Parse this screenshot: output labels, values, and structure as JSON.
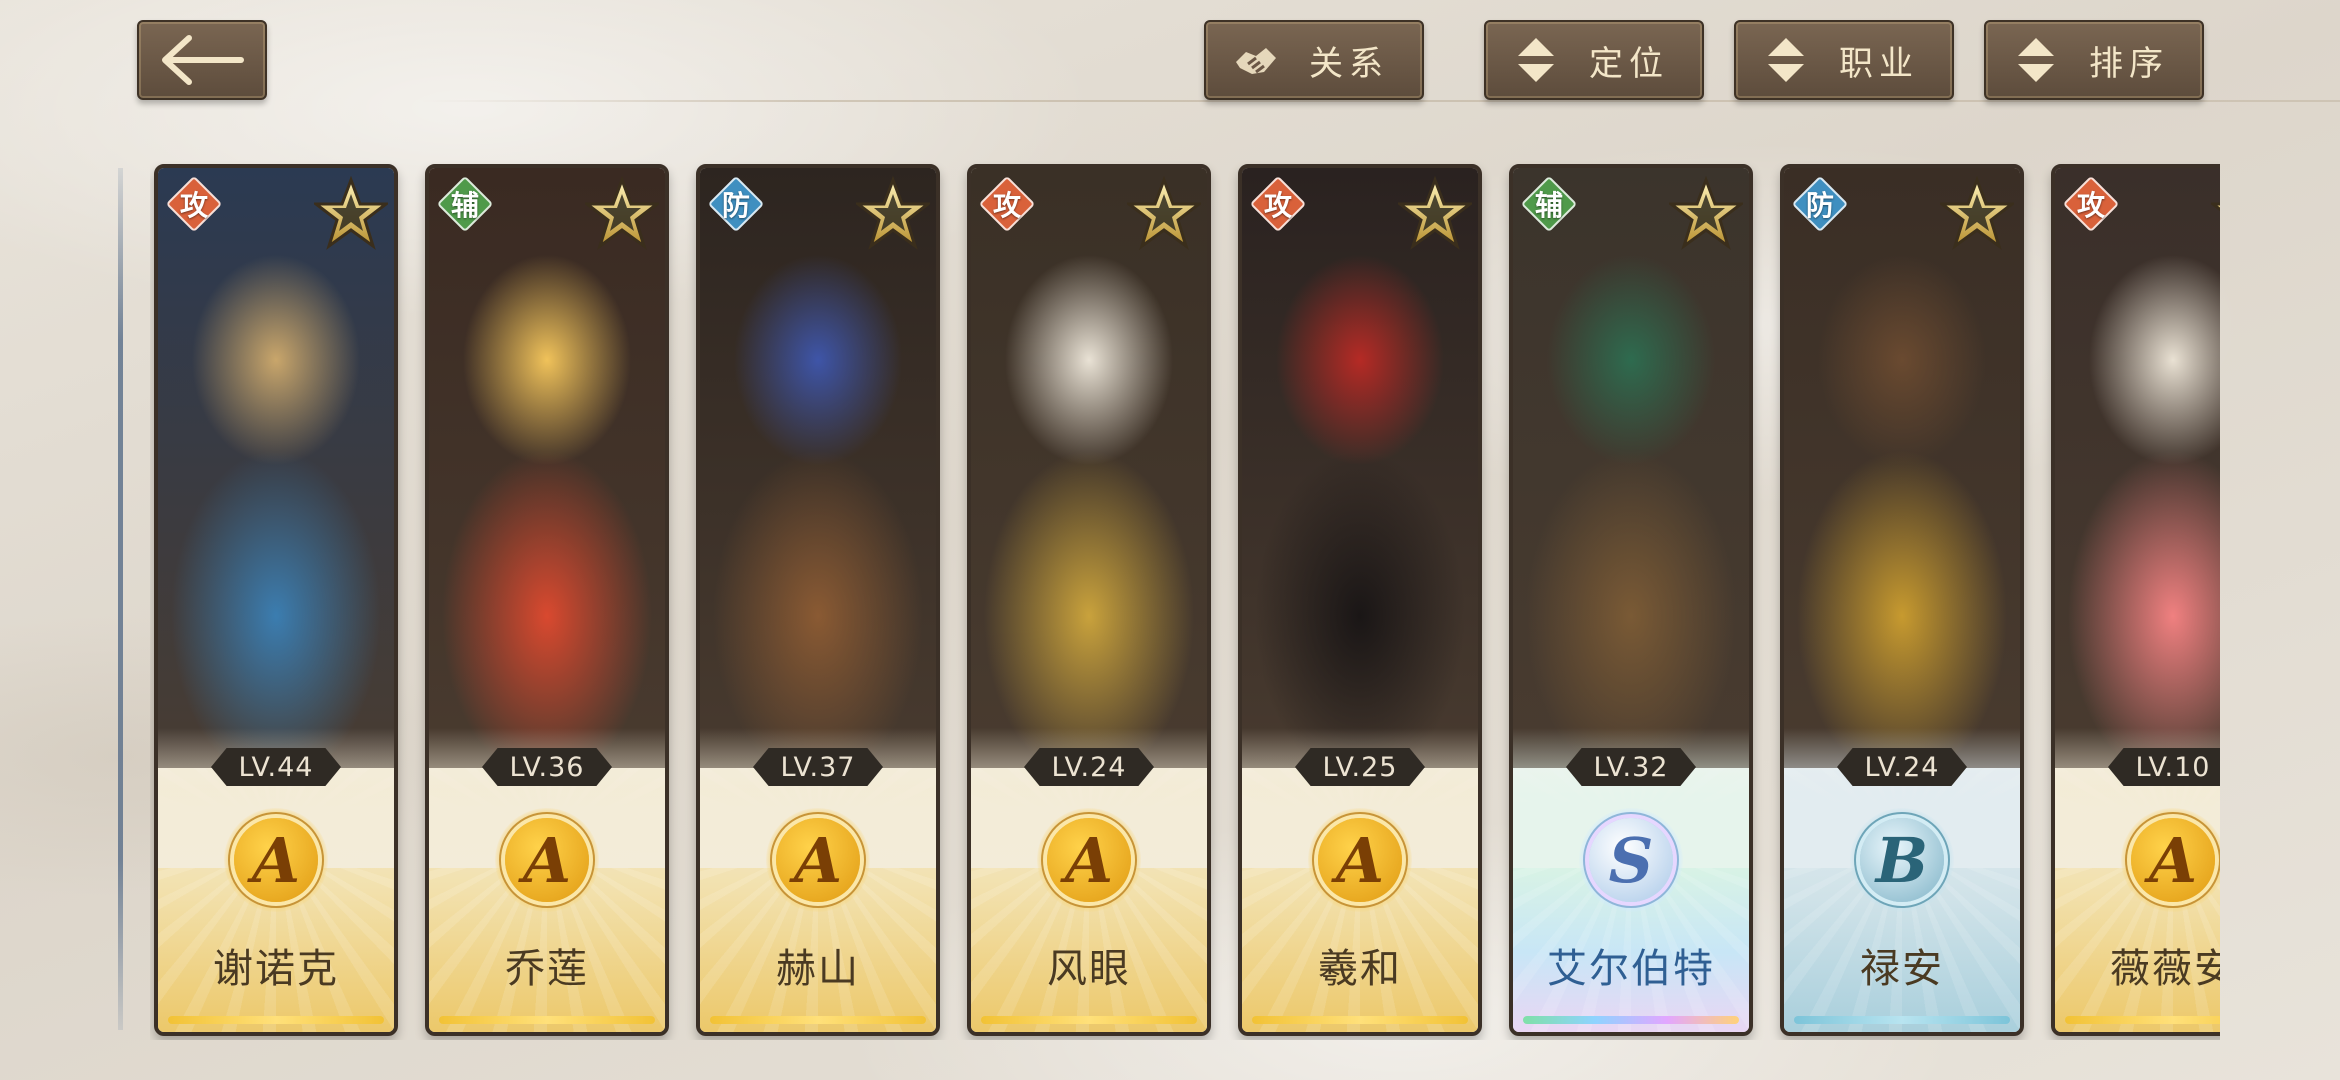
{
  "toolbar": {
    "relation_label": "关系",
    "position_label": "定位",
    "class_label": "职业",
    "sort_label": "排序"
  },
  "colors": {
    "button_bg": "#6b5746",
    "button_text": "#f3e6c8",
    "role_attack": "#d9613a",
    "role_support": "#4f9a4a",
    "role_defense": "#3f8fc0",
    "rarity_A": "#f2c235",
    "rarity_S": "#8fd3ff",
    "rarity_B": "#7cc4d9"
  },
  "heroes": [
    {
      "role": "攻",
      "level": "LV.44",
      "grade": "A",
      "name": "谢诺克",
      "portrait_colors": [
        "#2b3a52",
        "#3b7db0",
        "#c9a66b"
      ]
    },
    {
      "role": "辅",
      "level": "LV.36",
      "grade": "A",
      "name": "乔莲",
      "portrait_colors": [
        "#3a2a22",
        "#d9492f",
        "#f0c25a"
      ]
    },
    {
      "role": "防",
      "level": "LV.37",
      "grade": "A",
      "name": "赫山",
      "portrait_colors": [
        "#2d2520",
        "#8a5a33",
        "#3e55a8"
      ]
    },
    {
      "role": "攻",
      "level": "LV.24",
      "grade": "A",
      "name": "风眼",
      "portrait_colors": [
        "#3a3026",
        "#c9a23c",
        "#e9e2d5"
      ]
    },
    {
      "role": "攻",
      "level": "LV.25",
      "grade": "A",
      "name": "羲和",
      "portrait_colors": [
        "#2a2220",
        "#1a1616",
        "#b52a25"
      ]
    },
    {
      "role": "辅",
      "level": "LV.32",
      "grade": "S",
      "name": "艾尔伯特",
      "portrait_colors": [
        "#3b342c",
        "#7a5a35",
        "#2e6b4f"
      ]
    },
    {
      "role": "防",
      "level": "LV.24",
      "grade": "B",
      "name": "禄安",
      "portrait_colors": [
        "#3a2e25",
        "#c79a2f",
        "#6a4a30"
      ]
    },
    {
      "role": "攻",
      "level": "LV.10",
      "grade": "A",
      "name": "薇薇安",
      "portrait_colors": [
        "#3a2f2a",
        "#f08080",
        "#e9e1d3"
      ]
    }
  ]
}
